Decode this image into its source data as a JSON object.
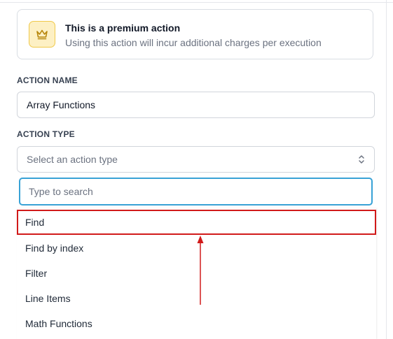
{
  "premium": {
    "icon": "crown-icon",
    "title": "This is a premium action",
    "subtitle": "Using this action will incur additional charges per execution"
  },
  "action_name": {
    "label": "ACTION NAME",
    "value": "Array Functions"
  },
  "action_type": {
    "label": "ACTION TYPE",
    "placeholder": "Select an action type",
    "icon": "chevron-up-down-icon"
  },
  "search": {
    "placeholder": "Type to search"
  },
  "options": [
    {
      "label": "Find",
      "highlighted": true
    },
    {
      "label": "Find by index"
    },
    {
      "label": "Filter"
    },
    {
      "label": "Line Items"
    },
    {
      "label": "Math Functions"
    }
  ],
  "colors": {
    "highlight_border": "#d11a1a",
    "focus_border": "#38a2d6",
    "premium_bg": "#fdf0c4",
    "premium_icon": "#b7860b"
  }
}
